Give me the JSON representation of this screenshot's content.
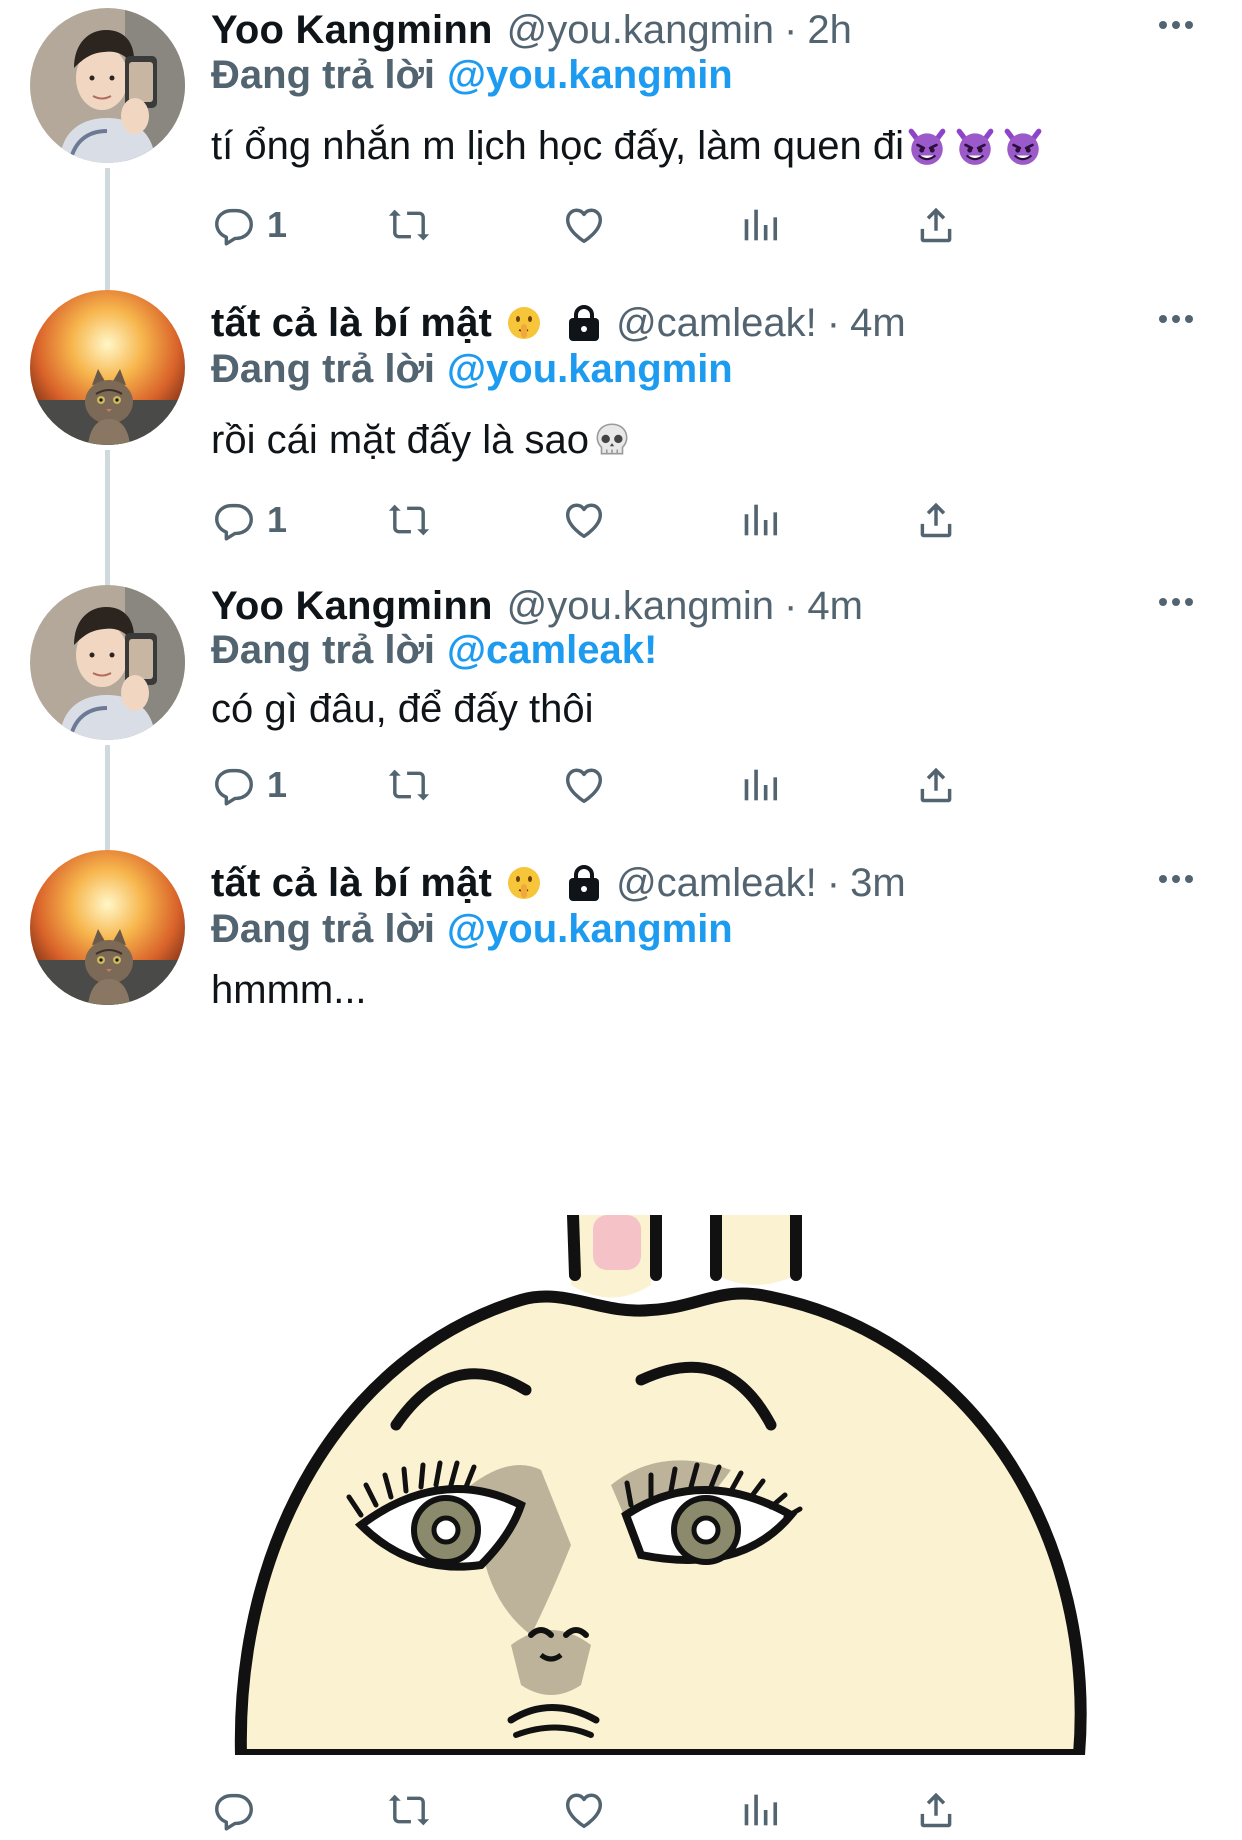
{
  "colors": {
    "accent": "#1d9bf0",
    "muted": "#536471",
    "text": "#0f1419",
    "thread": "#cfd9de"
  },
  "tweets": [
    {
      "name": "Yoo Kangminn",
      "handle": "@you.kangmin",
      "dot": "·",
      "time": "2h",
      "reply_prefix": "Đang trả lời",
      "reply_to": "@you.kangmin",
      "text": "tí ổng nhắn m lịch học đấy, làm quen đi",
      "text_emojis": [
        "smiling-imp-emoji",
        "smiling-imp-emoji",
        "smiling-imp-emoji"
      ],
      "reply_count": "1"
    },
    {
      "name": "tất cả là bí mật",
      "name_emoji": "shushing-face-emoji",
      "locked": true,
      "handle": "@camleak!",
      "dot": "·",
      "time": "4m",
      "reply_prefix": "Đang trả lời",
      "reply_to": "@you.kangmin",
      "text": "rồi cái mặt đấy là sao",
      "text_emojis": [
        "skull-emoji"
      ],
      "reply_count": "1"
    },
    {
      "name": "Yoo Kangminn",
      "handle": "@you.kangmin",
      "dot": "·",
      "time": "4m",
      "reply_prefix": "Đang trả lời",
      "reply_to": "@camleak!",
      "text": "có gì đâu, để đấy thôi",
      "reply_count": "1"
    },
    {
      "name": "tất cả là bí mật",
      "name_emoji": "shushing-face-emoji",
      "locked": true,
      "handle": "@camleak!",
      "dot": "·",
      "time": "3m",
      "reply_prefix": "Đang trả lời",
      "reply_to": "@you.kangmin",
      "text": "hmmm...",
      "media": "bunny-face-sticker"
    }
  ],
  "icons": [
    "reply-icon",
    "retweet-icon",
    "like-icon",
    "views-icon",
    "share-icon",
    "more-icon",
    "lock-icon"
  ]
}
